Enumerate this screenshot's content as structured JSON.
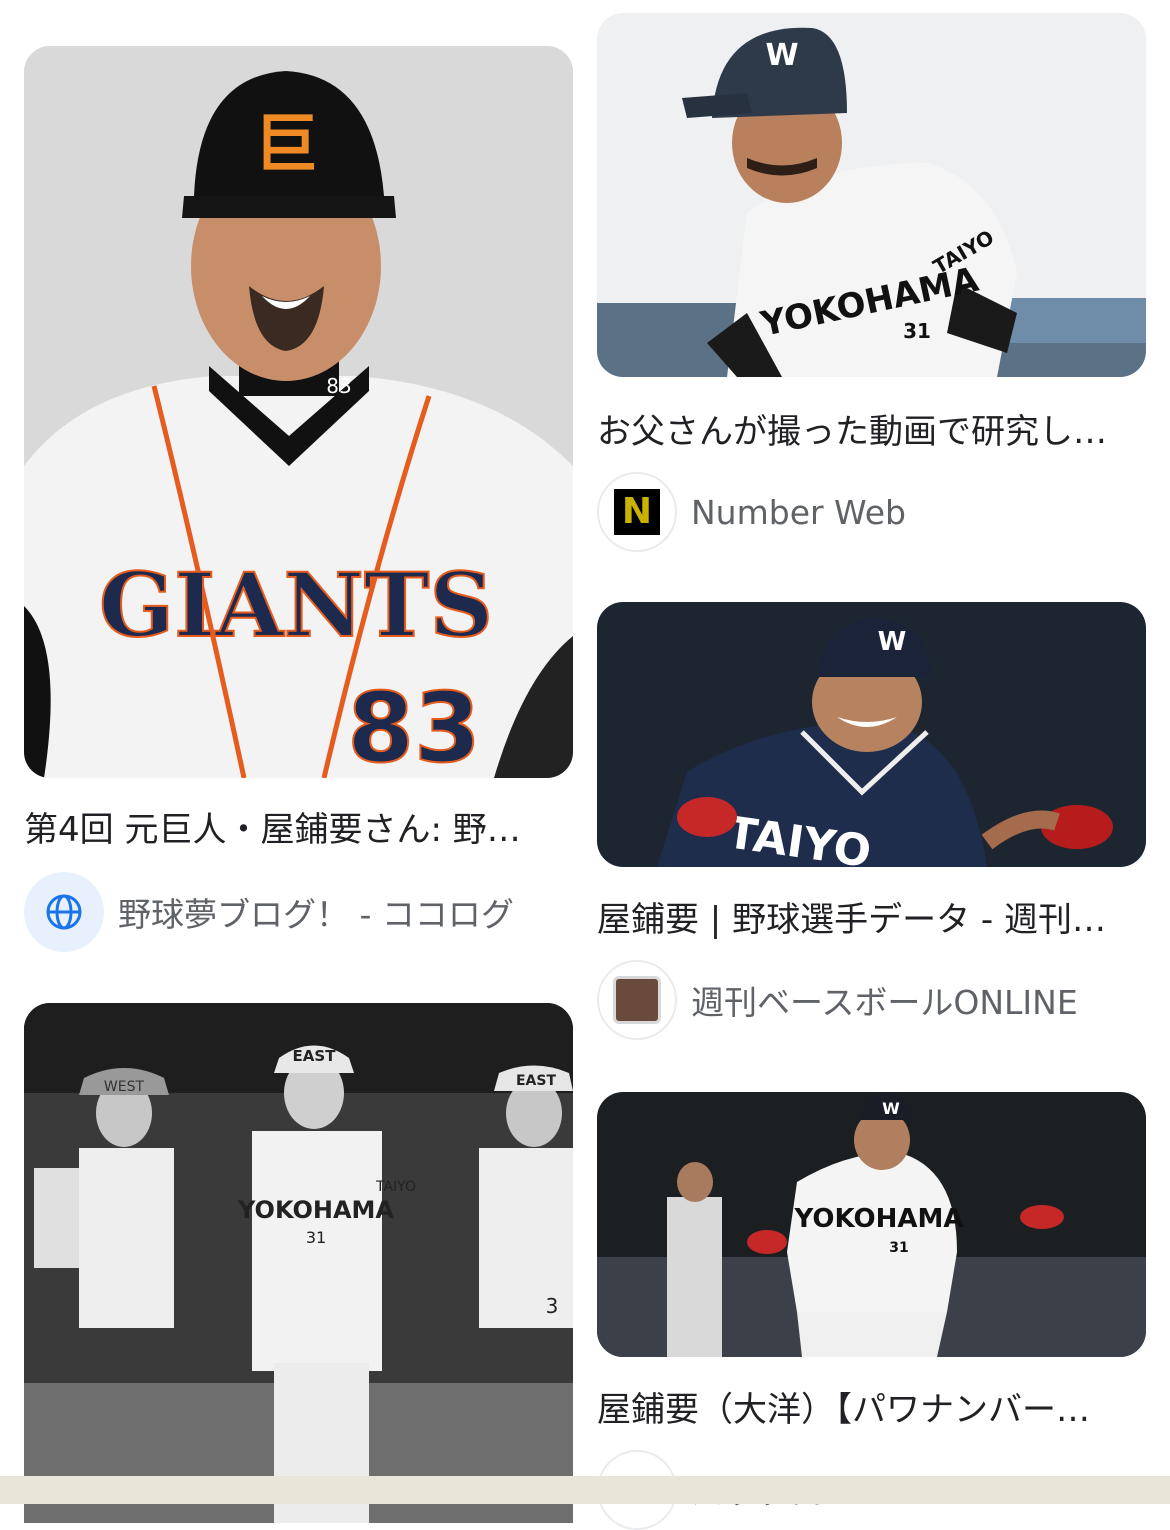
{
  "results": [
    {
      "title": "第4回 元巨人・屋鋪要さん: 野…",
      "source": "野球夢ブログ！ - ココログ",
      "source_icon": "globe-icon",
      "image_text": {
        "jersey": "GIANTS",
        "number": "83",
        "collar_number": "83"
      }
    },
    {
      "title": "お父さんが撮った動画で研究し…",
      "source": "Number Web",
      "source_icon": "number-web-logo",
      "logo_letter": "N",
      "image_text": {
        "helmet": "W",
        "jersey": "YOKOHAMA",
        "number": "31",
        "sleeve": "TAIYO"
      }
    },
    {
      "title": "屋鋪要 | 野球選手データ - 週刊…",
      "source": "週刊ベースボールONLINE",
      "source_icon": "baseball-online-logo",
      "image_text": {
        "helmet": "W",
        "jersey": "TAIYO"
      }
    },
    {
      "title": "屋鋪要（大洋）【パワナンバー…",
      "source": "パワプロ",
      "source_icon": "site-logo",
      "image_text": {
        "helmet": "W",
        "jersey": "YOKOHAMA",
        "number": "31"
      }
    },
    {
      "title": "",
      "source": "",
      "image_text": {
        "cap_left": "WEST",
        "cap_center": "EAST",
        "cap_right": "EAST",
        "jersey": "YOKOHAMA",
        "number": "31",
        "sleeve": "TAIYO",
        "number_right": "3"
      }
    }
  ],
  "colors": {
    "accent_blue": "#1a73e8",
    "title": "#202124",
    "source": "#5f6368"
  }
}
